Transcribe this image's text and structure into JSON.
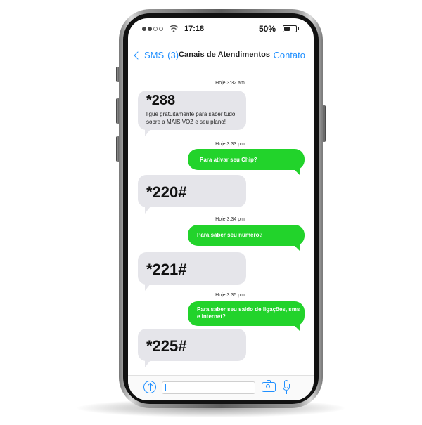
{
  "status_bar": {
    "time": "17:18",
    "battery_percent": "50%",
    "battery_level": 0.5
  },
  "nav": {
    "back_label": "SMS",
    "back_count": "(3)",
    "title": "Canais de Atendimentos",
    "contact_label": "Contato"
  },
  "messages": [
    {
      "timestamp": "Hoje 3:32 am"
    },
    {
      "code": "*288",
      "text_line1": "ligue gratuitamente para saber tudo",
      "text_line2": "sobre a MAIS VOZ e seu plano!"
    },
    {
      "timestamp": "Hoje 3:33 pm"
    },
    {
      "text": "Para ativar seu Chip?"
    },
    {
      "code": "*220#"
    },
    {
      "timestamp": "Hoje 3:34 pm"
    },
    {
      "text": "Para saber seu número?"
    },
    {
      "code": "*221#"
    },
    {
      "timestamp": "Hoje 3:35 pm"
    },
    {
      "text_line1": "Para saber seu saldo de ligações, sms",
      "text_line2": "e internet?"
    },
    {
      "code": "*225#"
    }
  ],
  "colors": {
    "accent_blue": "#1f8fff",
    "outgoing_green": "#22d32b",
    "incoming_gray": "#e5e5ea"
  },
  "icons": {
    "compose": "arrow-up-circle-icon",
    "camera": "camera-icon",
    "mic": "microphone-icon"
  }
}
